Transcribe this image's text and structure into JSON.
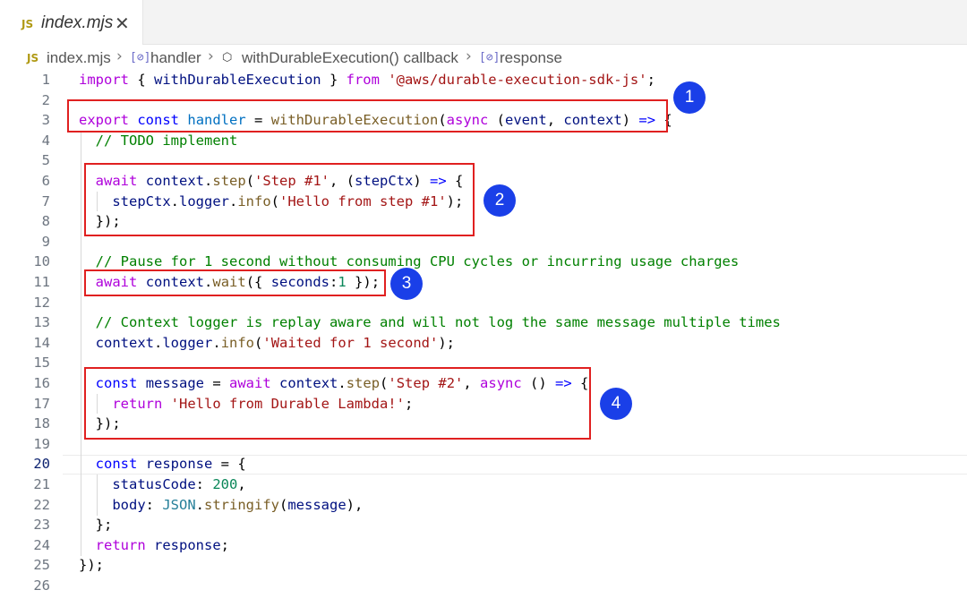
{
  "tab": {
    "lang": "JS",
    "name": "index.mjs",
    "close": "✕"
  },
  "breadcrumb": {
    "file_lang": "JS",
    "file": "index.mjs",
    "sep": "›",
    "item1_icon": "[⊘]",
    "item1": "handler",
    "item2_icon": "⬡",
    "item2": "withDurableExecution() callback",
    "item3_icon": "[⊘]",
    "item3": "response"
  },
  "active_line": 20,
  "code_lines": [
    "import { withDurableExecution } from '@aws/durable-execution-sdk-js';",
    "",
    "export const handler = withDurableExecution(async (event, context) => {",
    "  // TODO implement",
    "",
    "  await context.step('Step #1', (stepCtx) => {",
    "    stepCtx.logger.info('Hello from step #1');",
    "  });",
    "",
    "  // Pause for 1 second without consuming CPU cycles or incurring usage charges",
    "  await context.wait({ seconds:1 });",
    "",
    "  // Context logger is replay aware and will not log the same message multiple times",
    "  context.logger.info('Waited for 1 second');",
    "",
    "  const message = await context.step('Step #2', async () => {",
    "    return 'Hello from Durable Lambda!';",
    "  });",
    "",
    "  const response = {",
    "    statusCode: 200,",
    "    body: JSON.stringify(message),",
    "  };",
    "  return response;",
    "});",
    ""
  ],
  "annotations": [
    "1",
    "2",
    "3",
    "4"
  ],
  "colors": {
    "keyword": "#af00db",
    "storage": "#0000ff",
    "function": "#795e26",
    "string": "#a31515",
    "comment": "#008000",
    "variable": "#001080",
    "type": "#267f99",
    "number": "#098658",
    "highlight_box": "#e02020",
    "badge": "#1a3fe8"
  }
}
